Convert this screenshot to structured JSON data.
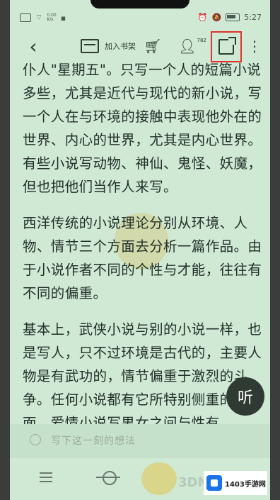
{
  "status": {
    "speed": "0.00",
    "speed_unit": "K/s",
    "time": "5:27"
  },
  "toolbar": {
    "back_icon": "chevron-left-icon",
    "add_to_shelf_label": "加入书架",
    "cart_icon": "cart-icon",
    "user_icon": "user-icon",
    "user_badge": "782",
    "share_icon": "share-icon",
    "more_icon": "more-vertical-icon"
  },
  "content": {
    "paragraphs": [
      "仆人\"星期五\"。只写一个人的短篇小说多些，尤其是近代与现代的新小说，写一个人在与环境的接触中表现他外在的世界、内心的世界，尤其是内心世界。有些小说写动物、神仙、鬼怪、妖魔，但也把他们当作人来写。",
      "西洋传统的小说理论分别从环境、人物、情节三个方面去分析一篇作品。由于小说作者不同的个性与才能，往往有不同的偏重。",
      "基本上，武侠小说与别的小说一样，也是写人，只不过环境是古代的，主要人物是有武功的，情节偏重于激烈的斗争。任何小说都有它所特别侧重的一面。爱情小说写男女之间与性有"
    ]
  },
  "listen_button": {
    "label": "听"
  },
  "comment": {
    "placeholder": "写下这一刻的想法"
  },
  "watermark": {
    "brand": "3DM",
    "site": "1403手游网"
  }
}
